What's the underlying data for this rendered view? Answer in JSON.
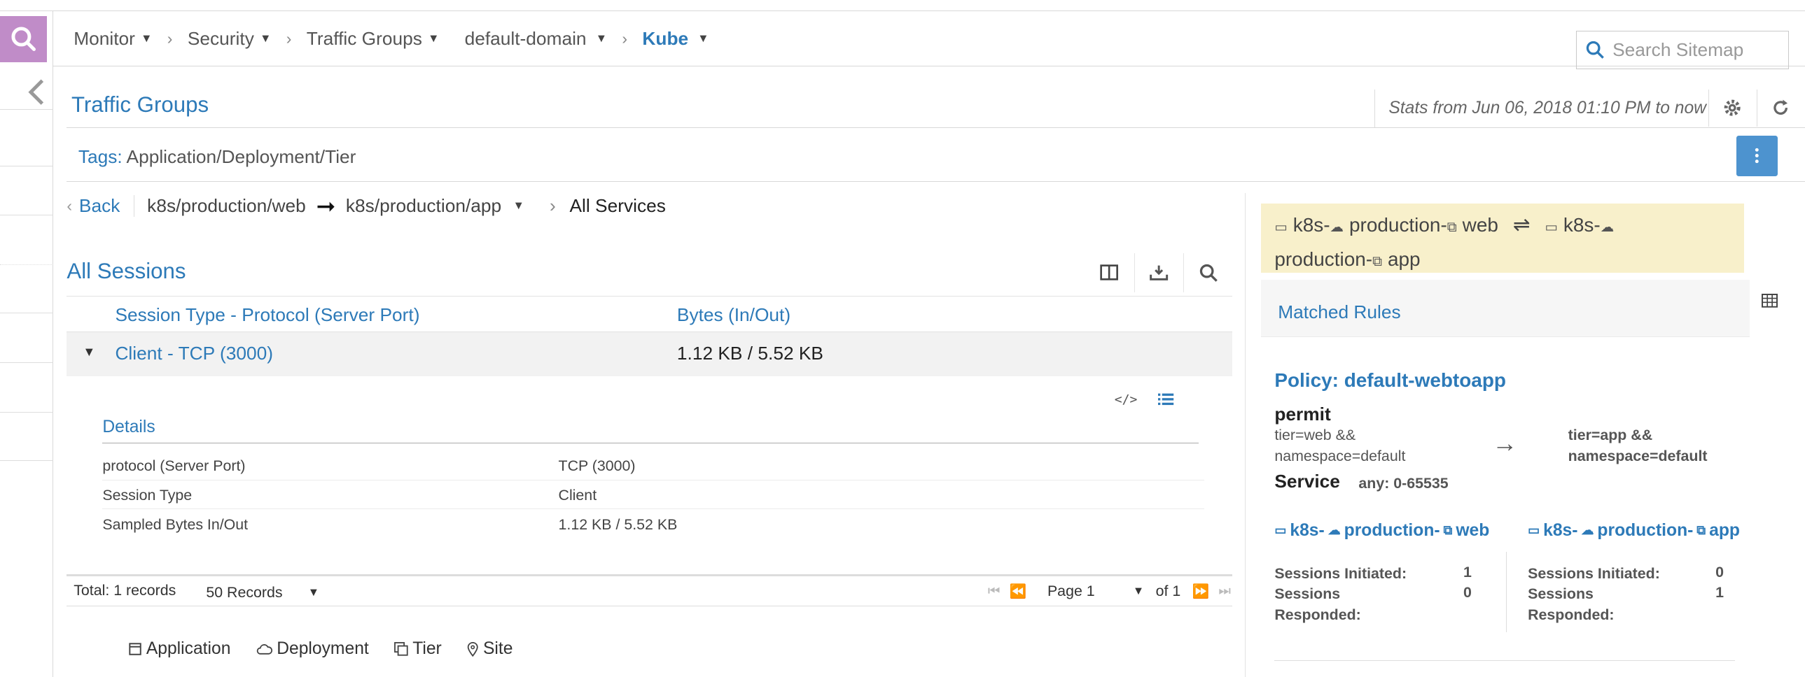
{
  "nav": {
    "crumbs": [
      "Monitor",
      "Security",
      "Traffic Groups",
      "default-domain",
      "Kube"
    ],
    "search_placeholder": "Search Sitemap"
  },
  "header": {
    "title": "Traffic Groups",
    "stats": "Stats from Jun 06, 2018 01:10 PM to now"
  },
  "tags": {
    "label": "Tags:",
    "value": "Application/Deployment/Tier"
  },
  "path": {
    "back": "Back",
    "source": "k8s/production/web",
    "dest": "k8s/production/app",
    "current": "All Services"
  },
  "sessions": {
    "title": "All Sessions",
    "columns": [
      "Session Type - Protocol (Server Port)",
      "Bytes (In/Out)"
    ],
    "row": {
      "name": "Client - TCP (3000)",
      "bytes": "1.12 KB / 5.52 KB"
    },
    "details": {
      "title": "Details",
      "rows": [
        {
          "key": "protocol (Server Port)",
          "value": "TCP (3000)"
        },
        {
          "key": "Session Type",
          "value": "Client"
        },
        {
          "key": "Sampled Bytes In/Out",
          "value": "1.12 KB / 5.52 KB"
        }
      ]
    },
    "footer": {
      "total": "Total: 1 records",
      "records": "50 Records",
      "page": "Page 1",
      "of": "of 1"
    }
  },
  "legend": [
    "Application",
    "Deployment",
    "Tier",
    "Site"
  ],
  "connection": {
    "a_prefix": "k8s-",
    "a_mid": "production-",
    "a_end": "web",
    "b_prefix": "k8s-",
    "b_mid": "production-",
    "b_end": "app"
  },
  "matched_rules": {
    "title": "Matched Rules",
    "policy": "Policy: default-webtoapp",
    "action": "permit",
    "src_line1": "tier=web &&",
    "src_line2": "namespace=default",
    "dst_line1": "tier=app &&",
    "dst_line2": "namespace=default",
    "service_label": "Service",
    "service_value": "any: 0-65535",
    "endpoints": [
      {
        "prefix": "k8s-",
        "mid": "production-",
        "end": "web",
        "initiated": "1",
        "responded": "0"
      },
      {
        "prefix": "k8s-",
        "mid": "production-",
        "end": "app",
        "initiated": "0",
        "responded": "1"
      }
    ],
    "initiated_label": "Sessions Initiated:",
    "responded_label_1": "Sessions",
    "responded_label_2": "Responded:"
  },
  "colors": {
    "link": "#2d7ab8",
    "highlight": "#f8f0cb",
    "search_tile": "#c08cc8",
    "kebab": "#4d93cf"
  }
}
